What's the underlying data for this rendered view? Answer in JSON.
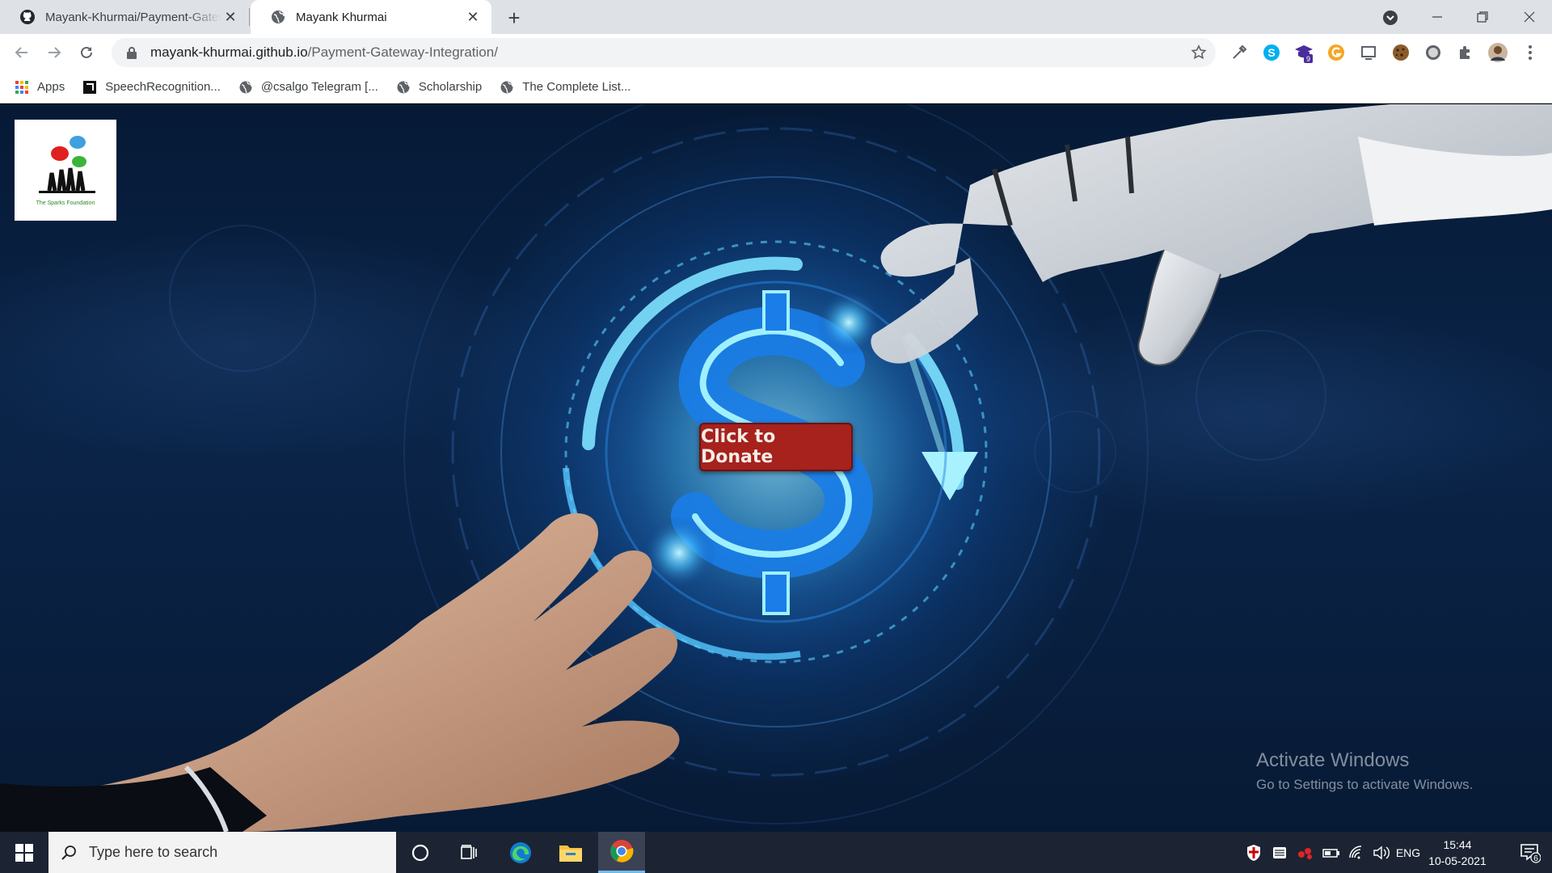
{
  "tabs": [
    {
      "title": "Mayank-Khurmai/Payment-Gateway-Integration",
      "icon": "github-icon",
      "active": false
    },
    {
      "title": "Mayank Khurmai",
      "icon": "globe-icon",
      "active": true
    }
  ],
  "address_bar": {
    "host": "mayank-khurmai.github.io",
    "path": "/Payment-Gateway-Integration/"
  },
  "bookmarks": [
    {
      "label": "Apps",
      "icon": "apps-grid-icon"
    },
    {
      "label": "SpeechRecognition...",
      "icon": "bookmark-app-icon"
    },
    {
      "label": "@csalgo Telegram [...",
      "icon": "globe-icon"
    },
    {
      "label": "Scholarship",
      "icon": "globe-icon"
    },
    {
      "label": "The Complete List...",
      "icon": "globe-icon"
    }
  ],
  "page": {
    "logo_caption": "The Sparks Foundation",
    "donate_button": "Click to Donate"
  },
  "watermark": {
    "title": "Activate Windows",
    "subtitle": "Go to Settings to activate Windows."
  },
  "extensions_badge": "9",
  "taskbar": {
    "search_placeholder": "Type here to search",
    "language": "ENG",
    "time": "15:44",
    "date": "10-05-2021",
    "notification_count": "6"
  },
  "colors": {
    "donate_button_bg": "#a7211d",
    "page_bg": "#0a2448",
    "taskbar_bg": "#1c2433"
  }
}
